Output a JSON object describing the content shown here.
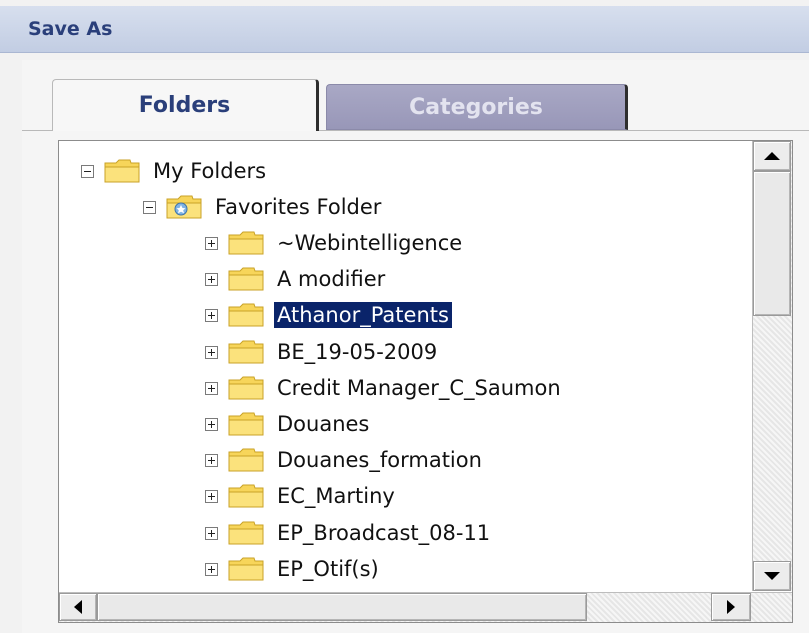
{
  "dialog": {
    "title": "Save As"
  },
  "tabs": [
    {
      "label": "Folders",
      "active": true
    },
    {
      "label": "Categories",
      "active": false
    }
  ],
  "tree": {
    "root": {
      "label": "My Folders",
      "expanded": true,
      "icon": "folder-icon"
    },
    "favorites": {
      "label": "Favorites Folder",
      "expanded": true,
      "icon": "favorites-folder-icon"
    },
    "items": [
      {
        "label": "~Webintelligence"
      },
      {
        "label": "A modifier"
      },
      {
        "label": "Athanor_Patents",
        "selected": true
      },
      {
        "label": "BE_19-05-2009"
      },
      {
        "label": "Credit Manager_C_Saumon"
      },
      {
        "label": "Douanes"
      },
      {
        "label": "Douanes_formation"
      },
      {
        "label": "EC_Martiny"
      },
      {
        "label": "EP_Broadcast_08-11"
      },
      {
        "label": "EP_Otif(s)"
      }
    ]
  },
  "colors": {
    "title_text": "#2a3f7a",
    "selection": "#0a246a",
    "inactive_tab": "#9f9ebd",
    "folder_yellow": "#f7d55a"
  }
}
